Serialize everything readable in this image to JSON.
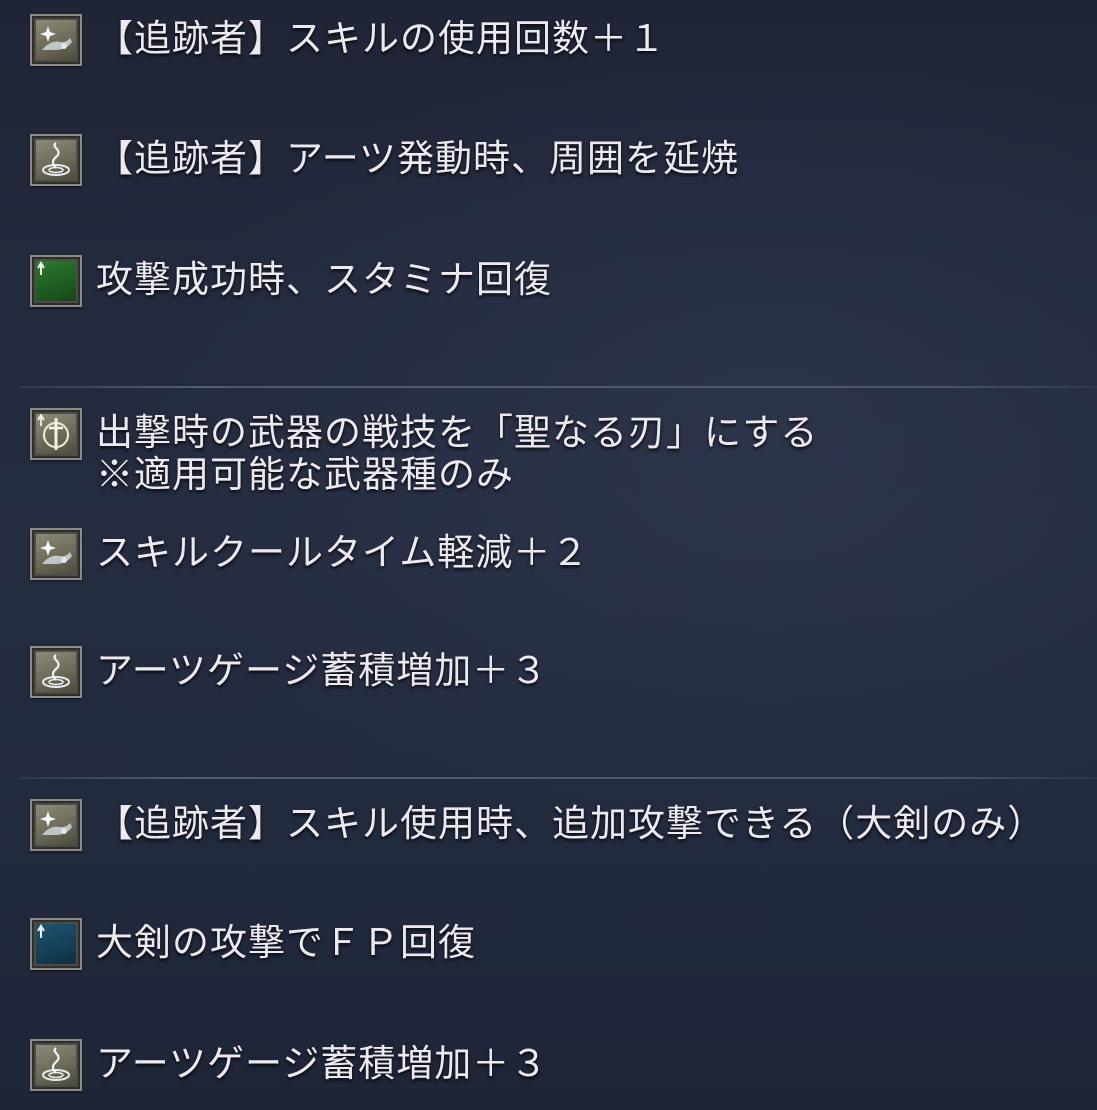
{
  "effects": [
    {
      "icon": "skill-icon",
      "text": "【追跡者】スキルの使用回数＋１"
    },
    {
      "icon": "arts-icon",
      "text": "【追跡者】アーツ発動時、周囲を延焼"
    },
    {
      "icon": "stamina-up-icon",
      "text": "攻撃成功時、スタミナ回復"
    },
    {
      "icon": "weapon-skill-icon",
      "text": "出撃時の武器の戦技を「聖なる刃」にする",
      "note": "※適用可能な武器種のみ"
    },
    {
      "icon": "skill-icon",
      "text": "スキルクールタイム軽減＋２"
    },
    {
      "icon": "arts-icon",
      "text": "アーツゲージ蓄積増加＋３"
    },
    {
      "icon": "skill-icon",
      "text": "【追跡者】スキル使用時、追加攻撃できる（大剣のみ）"
    },
    {
      "icon": "fp-up-icon",
      "text": "大剣の攻撃でＦＰ回復"
    },
    {
      "icon": "arts-icon",
      "text": "アーツゲージ蓄積増加＋３"
    }
  ],
  "colors": {
    "background": "#232a3d",
    "text": "#eceaf0",
    "icon_frame": "#8c8c86",
    "stamina_green": "#2d7a2f",
    "fp_blue": "#1f5470"
  }
}
